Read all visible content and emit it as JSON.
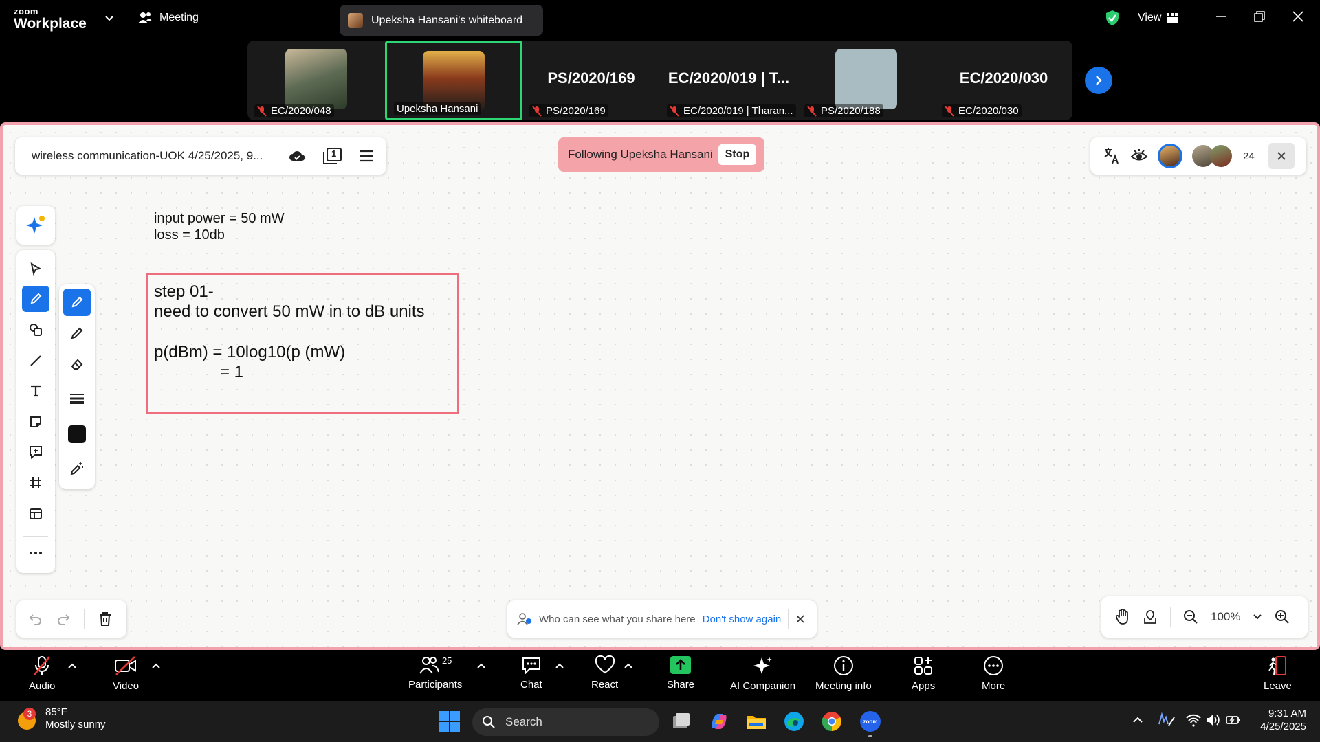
{
  "titlebar": {
    "logo_top": "zoom",
    "logo_bottom": "Workplace",
    "meeting_label": "Meeting",
    "whiteboard_tab": "Upeksha Hansani's whiteboard",
    "view_label": "View"
  },
  "participants_strip": [
    {
      "name": "EC/2020/048",
      "muted": true
    },
    {
      "name": "Upeksha Hansani",
      "active": true
    },
    {
      "name": "PS/2020/169",
      "big_label": "PS/2020/169",
      "muted": true
    },
    {
      "name": "EC/2020/019 | Tharan...",
      "big_label": "EC/2020/019 | T...",
      "muted": true
    },
    {
      "name": "PS/2020/188",
      "muted": true
    },
    {
      "name": "EC/2020/030",
      "big_label": "EC/2020/030",
      "muted": true
    }
  ],
  "whiteboard": {
    "file_name": "wireless communication-UOK 4/25/2025, 9...",
    "page_badge": "1",
    "following_text": "Following Upeksha Hansani",
    "stop_label": "Stop",
    "collaborator_count": "24",
    "canvas": {
      "line1": "input power = 50 mW",
      "line2": "loss = 10db",
      "box_line1": "step 01-",
      "box_line2": "need to convert 50 mW in to dB units",
      "box_line3": "p(dBm) = 10log10(p (mW)",
      "box_line4": "= 1"
    },
    "notice_text": "Who can see what you share here",
    "notice_link": "Don't show again",
    "zoom_level": "100%"
  },
  "meeting_controls": {
    "audio": "Audio",
    "video": "Video",
    "participants": "Participants",
    "participants_count": "25",
    "chat": "Chat",
    "react": "React",
    "share": "Share",
    "ai_companion": "AI Companion",
    "meeting_info": "Meeting info",
    "apps": "Apps",
    "more": "More",
    "leave": "Leave"
  },
  "taskbar": {
    "weather_temp": "85°F",
    "weather_desc": "Mostly sunny",
    "weather_badge": "3",
    "search_placeholder": "Search",
    "time": "9:31 AM",
    "date": "4/25/2025"
  },
  "colors": {
    "accent": "#1a73e8",
    "active_tile_border": "#2ed573",
    "board_border": "#f2a2ac",
    "follow_banner": "#f4a3a8",
    "box_border": "#ef6e7d",
    "share_green": "#22c55e",
    "mute_red": "#e53935"
  }
}
